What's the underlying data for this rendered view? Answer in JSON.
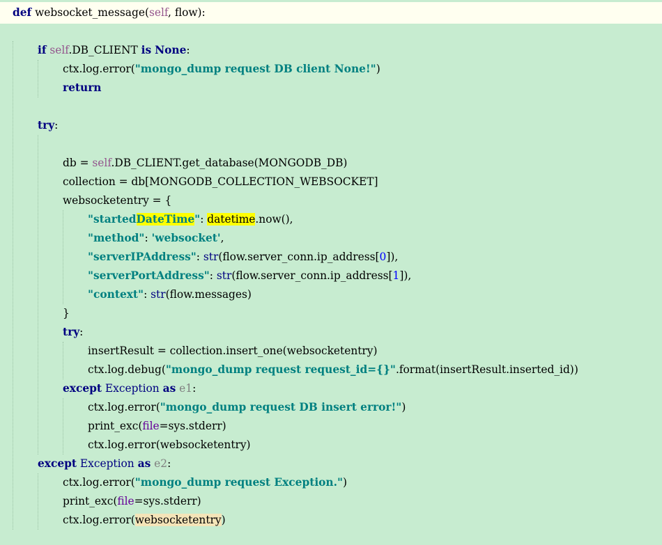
{
  "code_lines": [
    {
      "segments": [
        {
          "t": "def",
          "c": "kw"
        },
        {
          "t": " websocket_message("
        },
        {
          "t": "self",
          "c": "self"
        },
        {
          "t": ", flow):"
        }
      ]
    },
    {
      "segments": []
    },
    {
      "segments": [
        {
          "t": "if",
          "c": "kw"
        },
        {
          "t": " "
        },
        {
          "t": "self",
          "c": "self"
        },
        {
          "t": ".DB_CLIENT "
        },
        {
          "t": "is",
          "c": "kw"
        },
        {
          "t": " "
        },
        {
          "t": "None",
          "c": "kw"
        },
        {
          "t": ":"
        }
      ]
    },
    {
      "segments": [
        {
          "t": "ctx.log.error("
        },
        {
          "t": "\"mongo_dump request DB client None!\"",
          "c": "str"
        },
        {
          "t": ")"
        }
      ]
    },
    {
      "segments": [
        {
          "t": "return",
          "c": "kw"
        }
      ]
    },
    {
      "segments": []
    },
    {
      "segments": [
        {
          "t": "try",
          "c": "kw"
        },
        {
          "t": ":"
        }
      ]
    },
    {
      "segments": []
    },
    {
      "segments": [
        {
          "t": "db = "
        },
        {
          "t": "self",
          "c": "self"
        },
        {
          "t": ".DB_CLIENT.get_database(MONGODB_DB)"
        }
      ]
    },
    {
      "segments": [
        {
          "t": "collection = db[MONGODB_COLLECTION_WEBSOCKET]"
        }
      ]
    },
    {
      "segments": [
        {
          "t": "websocketentry = {"
        }
      ]
    },
    {
      "segments": [
        {
          "t": "\"started",
          "c": "str"
        },
        {
          "t": "DateTime",
          "c": "str hl-yellow"
        },
        {
          "t": "\"",
          "c": "str"
        },
        {
          "t": ": "
        },
        {
          "t": "datetime",
          "c": "hl-yellow"
        },
        {
          "t": ".now(),"
        }
      ]
    },
    {
      "segments": [
        {
          "t": "\"method\"",
          "c": "str"
        },
        {
          "t": ": "
        },
        {
          "t": "'websocket'",
          "c": "str"
        },
        {
          "t": ","
        }
      ]
    },
    {
      "segments": [
        {
          "t": "\"serverIPAddress\"",
          "c": "str"
        },
        {
          "t": ": "
        },
        {
          "t": "str",
          "c": "builtin"
        },
        {
          "t": "(flow.server_conn.ip_address["
        },
        {
          "t": "0",
          "c": "num"
        },
        {
          "t": "]),"
        }
      ]
    },
    {
      "segments": [
        {
          "t": "\"serverPortAddress\"",
          "c": "str"
        },
        {
          "t": ": "
        },
        {
          "t": "str",
          "c": "builtin"
        },
        {
          "t": "(flow.server_conn.ip_address["
        },
        {
          "t": "1",
          "c": "num"
        },
        {
          "t": "]),"
        }
      ]
    },
    {
      "segments": [
        {
          "t": "\"context\"",
          "c": "str"
        },
        {
          "t": ": "
        },
        {
          "t": "str",
          "c": "builtin"
        },
        {
          "t": "(flow.messages)"
        }
      ]
    },
    {
      "segments": [
        {
          "t": "}"
        }
      ]
    },
    {
      "segments": [
        {
          "t": "try",
          "c": "kw"
        },
        {
          "t": ":"
        }
      ]
    },
    {
      "segments": [
        {
          "t": "insertResult = collection.insert_one(websocketentry)"
        }
      ]
    },
    {
      "segments": [
        {
          "t": "ctx.log.debug("
        },
        {
          "t": "\"mongo_dump request request_id={}\"",
          "c": "str"
        },
        {
          "t": ".format(insertResult.inserted_id))"
        }
      ]
    },
    {
      "segments": [
        {
          "t": "except",
          "c": "kw"
        },
        {
          "t": " "
        },
        {
          "t": "Exception",
          "c": "builtin"
        },
        {
          "t": " "
        },
        {
          "t": "as",
          "c": "kw"
        },
        {
          "t": " "
        },
        {
          "t": "e1",
          "c": "unused"
        },
        {
          "t": ":"
        }
      ]
    },
    {
      "segments": [
        {
          "t": "ctx.log.error("
        },
        {
          "t": "\"mongo_dump request DB insert error!\"",
          "c": "str"
        },
        {
          "t": ")"
        }
      ]
    },
    {
      "segments": [
        {
          "t": "print_exc("
        },
        {
          "t": "file",
          "c": "param"
        },
        {
          "t": "=sys.stderr)"
        }
      ]
    },
    {
      "segments": [
        {
          "t": "ctx.log.error(websocketentry)"
        }
      ]
    },
    {
      "segments": [
        {
          "t": "except",
          "c": "kw"
        },
        {
          "t": " "
        },
        {
          "t": "Exception",
          "c": "builtin"
        },
        {
          "t": " "
        },
        {
          "t": "as",
          "c": "kw"
        },
        {
          "t": " "
        },
        {
          "t": "e2",
          "c": "unused"
        },
        {
          "t": ":"
        }
      ]
    },
    {
      "segments": [
        {
          "t": "ctx.log.error("
        },
        {
          "t": "\"mongo_dump request Exception.\"",
          "c": "str"
        },
        {
          "t": ")"
        }
      ]
    },
    {
      "segments": [
        {
          "t": "print_exc("
        },
        {
          "t": "file",
          "c": "param"
        },
        {
          "t": "=sys.stderr)"
        }
      ]
    },
    {
      "segments": [
        {
          "t": "ctx.log.error("
        },
        {
          "t": "websocketentry",
          "c": "hl-ref"
        },
        {
          "t": ")"
        }
      ]
    }
  ],
  "colors": {
    "background": "#c7ecd0",
    "current_line": "#fffff0",
    "keyword": "#000080",
    "string": "#008080",
    "self": "#94558d",
    "number": "#0000ff",
    "highlight": "#ffff00",
    "reference_highlight": "#f4e4b8"
  }
}
